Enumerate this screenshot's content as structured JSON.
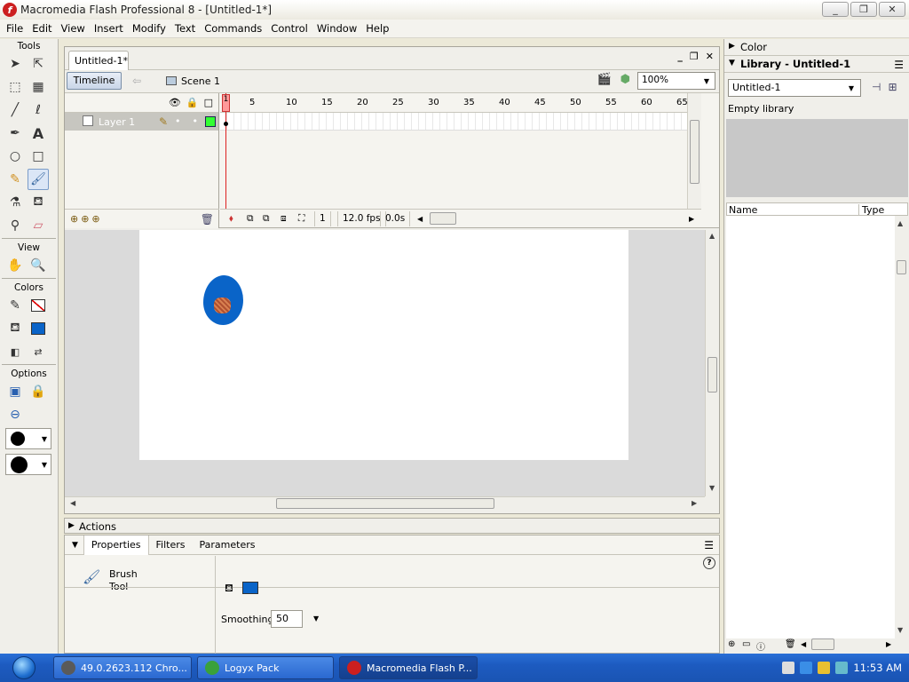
{
  "window": {
    "title": "Macromedia Flash Professional 8 - [Untitled-1*]",
    "app_icon": "f",
    "controls": [
      "_",
      "❐",
      "✕"
    ]
  },
  "menu": [
    "File",
    "Edit",
    "View",
    "Insert",
    "Modify",
    "Text",
    "Commands",
    "Control",
    "Window",
    "Help"
  ],
  "tools_panel": {
    "tools_label": "Tools",
    "view_label": "View",
    "colors_label": "Colors",
    "options_label": "Options"
  },
  "document": {
    "tab_label": "Untitled-1*",
    "timeline_button": "Timeline",
    "scene_label": "Scene 1",
    "zoom_value": "100%",
    "controls": [
      "_",
      "❐",
      "✕"
    ]
  },
  "timeline": {
    "layer_name": "Layer 1",
    "ruler_ticks": [
      "1",
      "5",
      "10",
      "15",
      "20",
      "25",
      "30",
      "35",
      "40",
      "45",
      "50",
      "55",
      "60",
      "65"
    ],
    "current_frame": "1",
    "fps": "12.0 fps",
    "elapsed": "0.0s"
  },
  "stage": {
    "fill_color": "#0a64c8"
  },
  "actions_panel": {
    "label": "Actions"
  },
  "properties": {
    "tabs": [
      "Properties",
      "Filters",
      "Parameters"
    ],
    "tool_name": "Brush",
    "tool_name_2": "Tool",
    "smoothing_label": "Smoothing",
    "smoothing_value": "50",
    "help": "?"
  },
  "right_panels": {
    "color_label": "Color",
    "library_label": "Library - Untitled-1",
    "library_select": "Untitled-1",
    "empty_library": "Empty library",
    "col_name": "Name",
    "col_type": "Type"
  },
  "taskbar": {
    "items": [
      {
        "label": "49.0.2623.112 Chro...",
        "color": "#5a5a5a"
      },
      {
        "label": "Logyx Pack",
        "color": "#3aa13a"
      },
      {
        "label": "Macromedia Flash P...",
        "color": "#cc1f1f"
      }
    ],
    "clock": "11:53 AM"
  }
}
